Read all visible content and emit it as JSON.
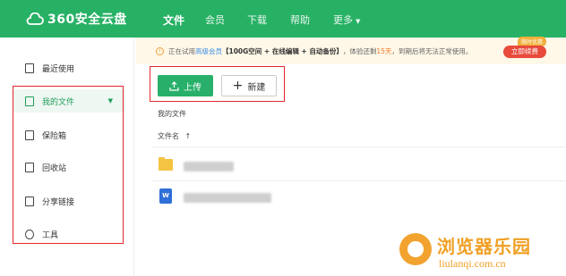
{
  "topbar": {
    "logo_text": "360安全云盘",
    "nav": [
      {
        "label": "文件"
      },
      {
        "label": "会员"
      },
      {
        "label": "下载"
      },
      {
        "label": "帮助"
      },
      {
        "label": "更多"
      }
    ]
  },
  "sidebar": {
    "items": [
      {
        "label": "最近使用",
        "icon": "recent-icon"
      },
      {
        "label": "我的文件",
        "icon": "file-icon"
      },
      {
        "label": "保险箱",
        "icon": "safe-icon"
      },
      {
        "label": "回收站",
        "icon": "trash-icon"
      },
      {
        "label": "分享链接",
        "icon": "share-link-icon"
      },
      {
        "label": "工具",
        "icon": "tool-icon"
      }
    ]
  },
  "notice": {
    "prefix": "正在试用",
    "vip": "高级会员",
    "features": "【100G空间 + 在线编辑 + 自动备份】",
    "trial_a": "，体验还剩",
    "days": "15天",
    "trial_b": "，到期后将无法正常使用。",
    "badge": "限时优惠",
    "renew": "立即续费"
  },
  "toolbar": {
    "upload": "上传",
    "new": "新建"
  },
  "main": {
    "breadcrumb": "我的文件",
    "column_name": "文件名",
    "sort_arrow": "↑"
  },
  "watermark": {
    "cn": "浏览器乐园",
    "url": "liulanqi.com.cn"
  },
  "colors": {
    "brand_green": "#27b165",
    "highlight_red": "#e0282e",
    "renew_red": "#e84a3c"
  }
}
